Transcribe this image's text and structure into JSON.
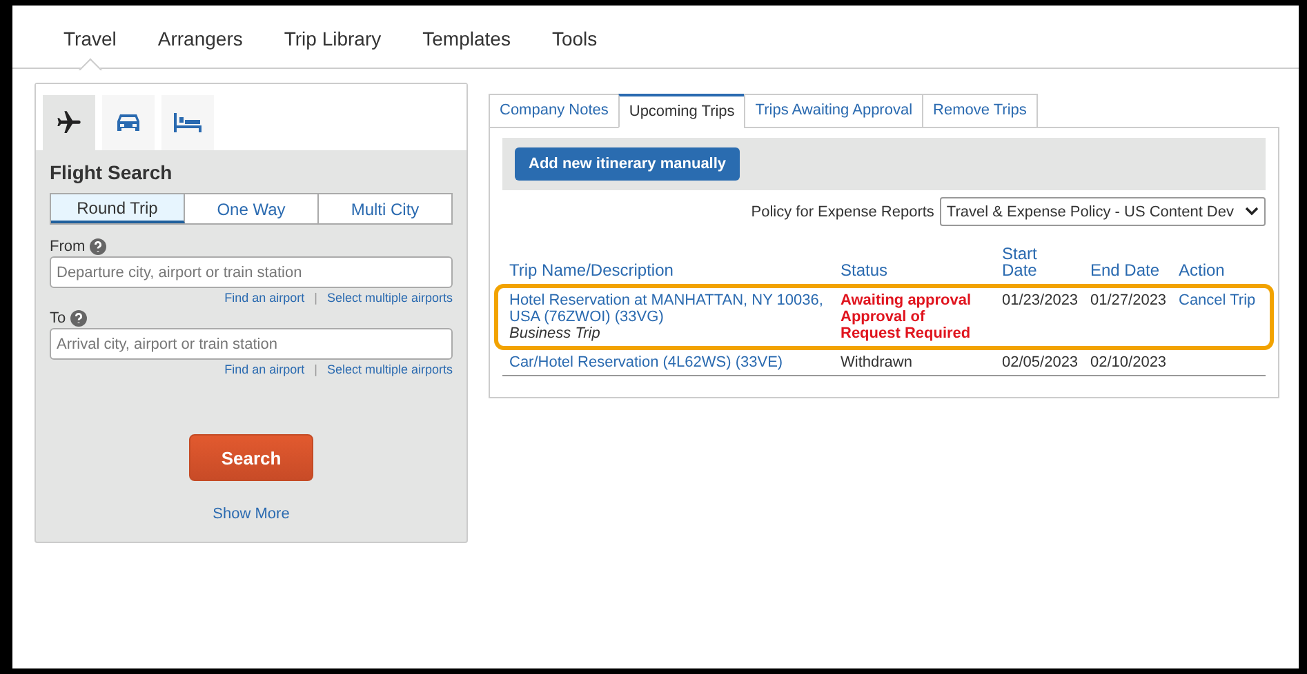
{
  "nav_tabs": [
    {
      "label": "Travel",
      "selected": true
    },
    {
      "label": "Arrangers",
      "selected": false
    },
    {
      "label": "Trip Library",
      "selected": false
    },
    {
      "label": "Templates",
      "selected": false
    },
    {
      "label": "Tools",
      "selected": false
    }
  ],
  "search_panel": {
    "modes": [
      {
        "kind": "flight",
        "selected": true
      },
      {
        "kind": "car",
        "selected": false
      },
      {
        "kind": "hotel",
        "selected": false
      }
    ],
    "title": "Flight Search",
    "trip_types": [
      {
        "label": "Round Trip",
        "selected": true
      },
      {
        "label": "One Way",
        "selected": false
      },
      {
        "label": "Multi City",
        "selected": false
      }
    ],
    "fields": [
      {
        "label": "From",
        "placeholder": "Departure city, airport or train station",
        "links": [
          "Find an airport",
          "Select multiple airports"
        ],
        "separator": "|"
      },
      {
        "label": "To",
        "placeholder": "Arrival city, airport or train station",
        "links": [
          "Find an airport",
          "Select multiple airports"
        ],
        "separator": "|"
      }
    ],
    "search_button": "Search",
    "show_more": "Show More"
  },
  "trips_panel": {
    "tabs": [
      {
        "label": "Company Notes",
        "selected": false
      },
      {
        "label": "Upcoming Trips",
        "selected": true
      },
      {
        "label": "Trips Awaiting Approval",
        "selected": false
      },
      {
        "label": "Remove Trips",
        "selected": false
      }
    ],
    "add_button": "Add new itinerary manually",
    "policy_label": "Policy for Expense Reports",
    "policy_value": "Travel & Expense Policy - US Content Dev",
    "columns": [
      "Trip Name/Description",
      "Status",
      "Start Date",
      "End Date",
      "Action"
    ],
    "rows": [
      {
        "name": "Hotel Reservation at MANHATTAN, NY 10036, USA (76ZWOI) (33VG)",
        "type": "Business Trip",
        "status": [
          "Awaiting approval",
          "Approval of Request Required"
        ],
        "alert": true,
        "start": "01/23/2023",
        "end": "01/27/2023",
        "action": "Cancel Trip",
        "highlighted": true
      },
      {
        "name": "Car/Hotel Reservation (4L62WS) (33VE)",
        "status": [
          "Withdrawn"
        ],
        "alert": false,
        "start": "02/05/2023",
        "end": "02/10/2023",
        "highlighted": false
      }
    ]
  }
}
